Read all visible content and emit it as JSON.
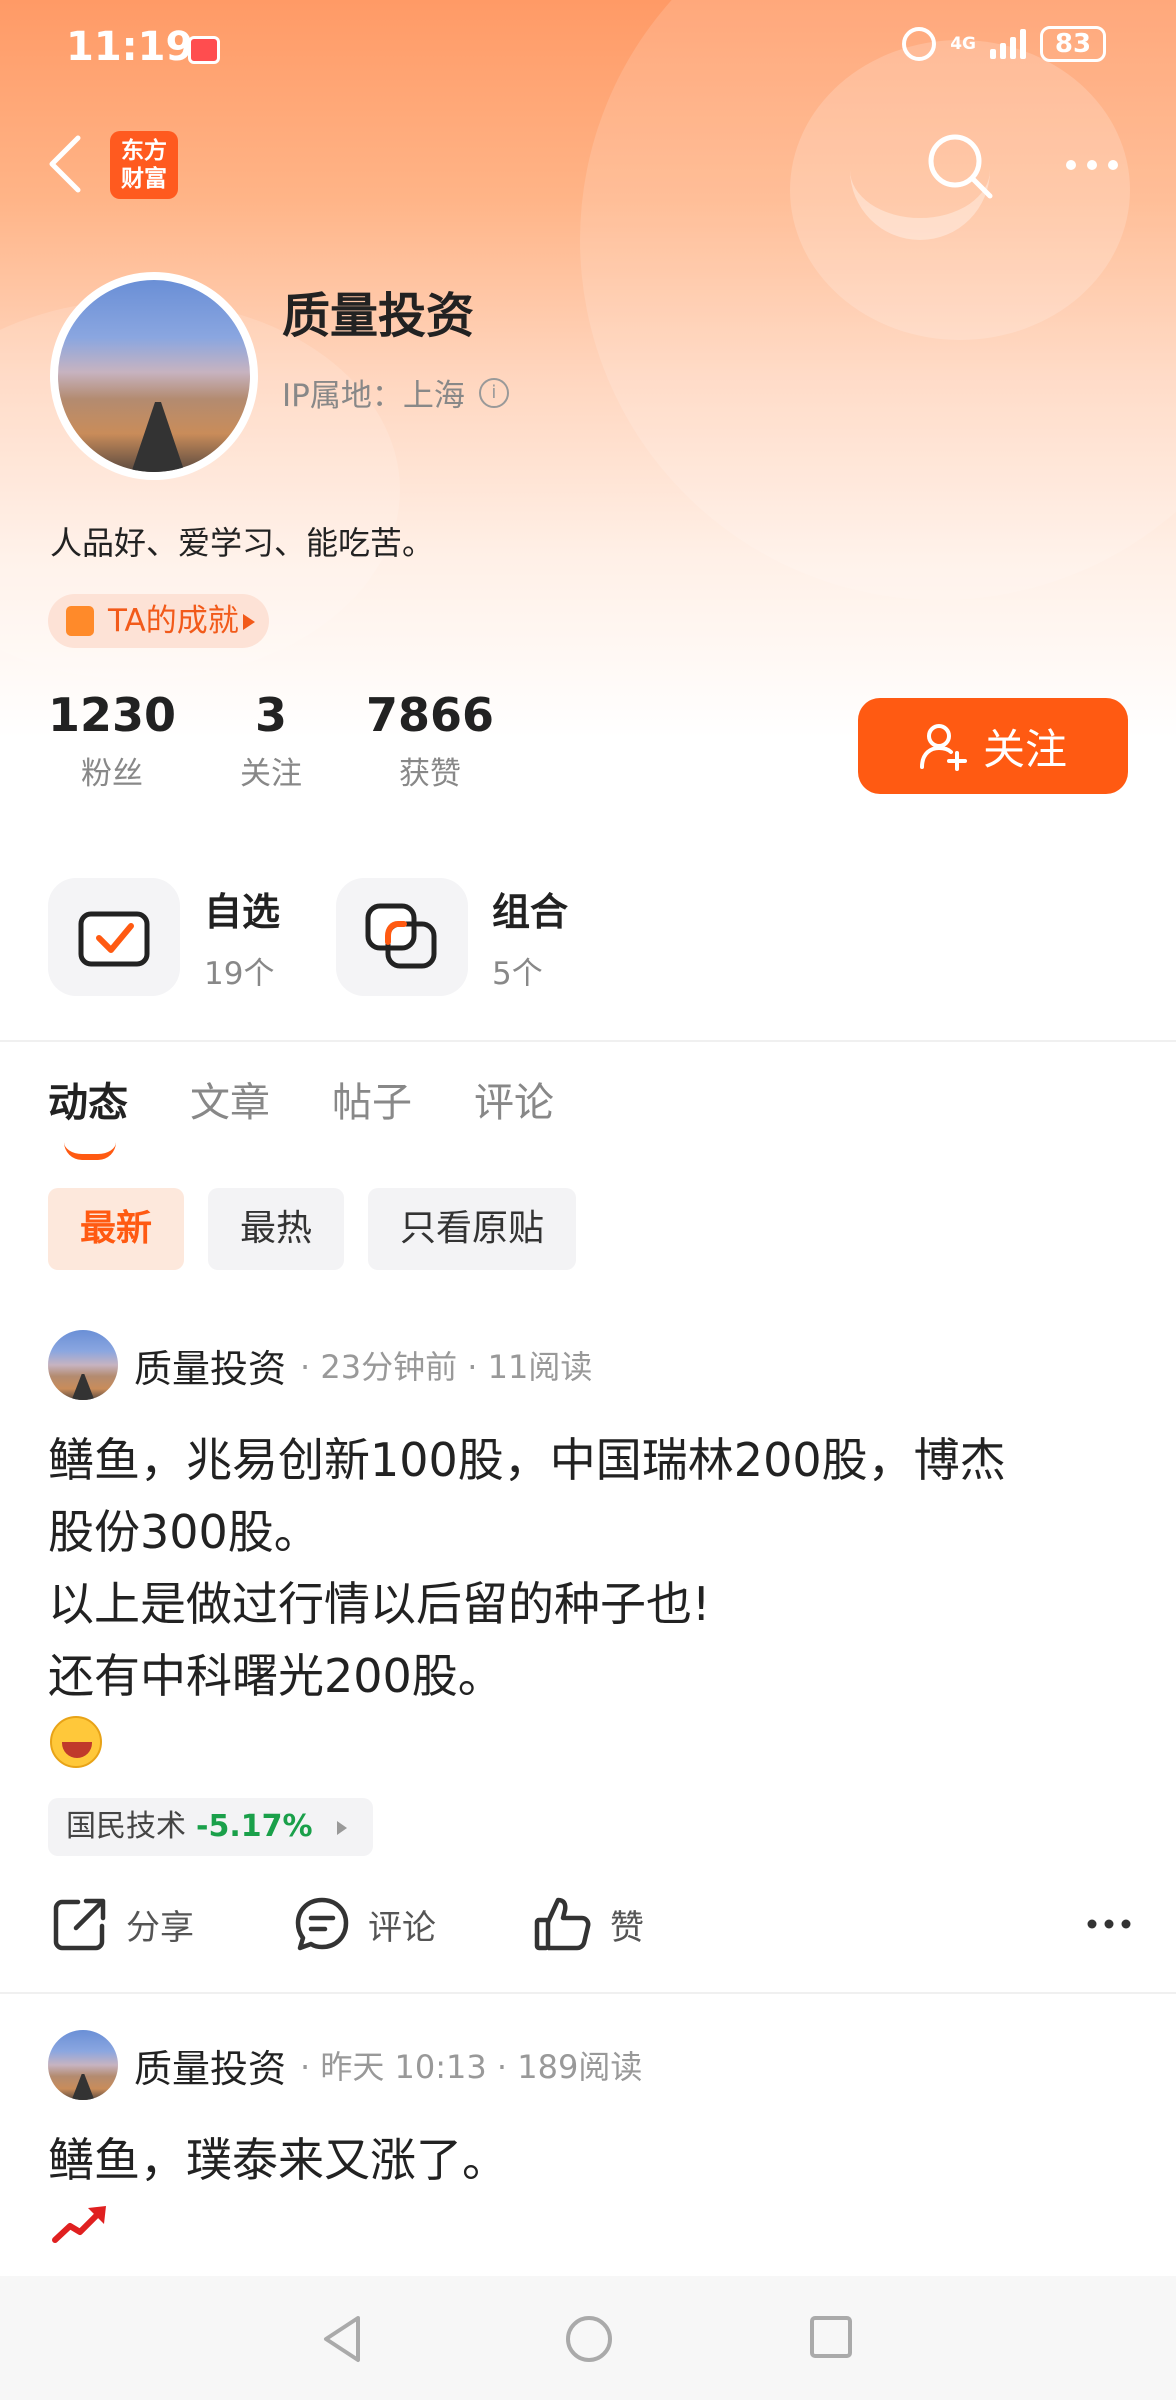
{
  "status_bar": {
    "time": "11:19",
    "network": "4G",
    "battery": "83"
  },
  "nav": {
    "logo_text": "东方财富"
  },
  "profile": {
    "name": "质量投资",
    "ip": "IP属地：上海",
    "bio": "人品好、爱学习、能吃苦。",
    "achievement": "TA的成就",
    "stats": [
      {
        "num": "1230",
        "label": "粉丝"
      },
      {
        "num": "3",
        "label": "关注"
      },
      {
        "num": "7866",
        "label": "获赞"
      }
    ],
    "follow_button": "关注"
  },
  "quick_links": [
    {
      "title": "自选",
      "count": "19个"
    },
    {
      "title": "组合",
      "count": "5个"
    }
  ],
  "tabs": [
    "动态",
    "文章",
    "帖子",
    "评论"
  ],
  "filters": [
    "最新",
    "最热",
    "只看原贴"
  ],
  "posts": [
    {
      "author": "质量投资",
      "meta": "· 23分钟前 · 11阅读",
      "lines": [
        "鳝鱼，兆易创新100股，中国瑞林200股，博杰",
        "股份300股。",
        "以上是做过行情以后留的种子也!",
        "还有中科曙光200股。"
      ],
      "stock": {
        "name": "国民技术",
        "change": "-5.17%"
      },
      "actions": {
        "share": "分享",
        "comment": "评论",
        "like": "赞"
      }
    },
    {
      "author": "质量投资",
      "meta": "· 昨天 10:13 · 189阅读",
      "lines": [
        "鳝鱼，璞泰来又涨了。"
      ]
    }
  ],
  "colors": {
    "accent": "#ff5a12",
    "down": "#1aa04a"
  }
}
